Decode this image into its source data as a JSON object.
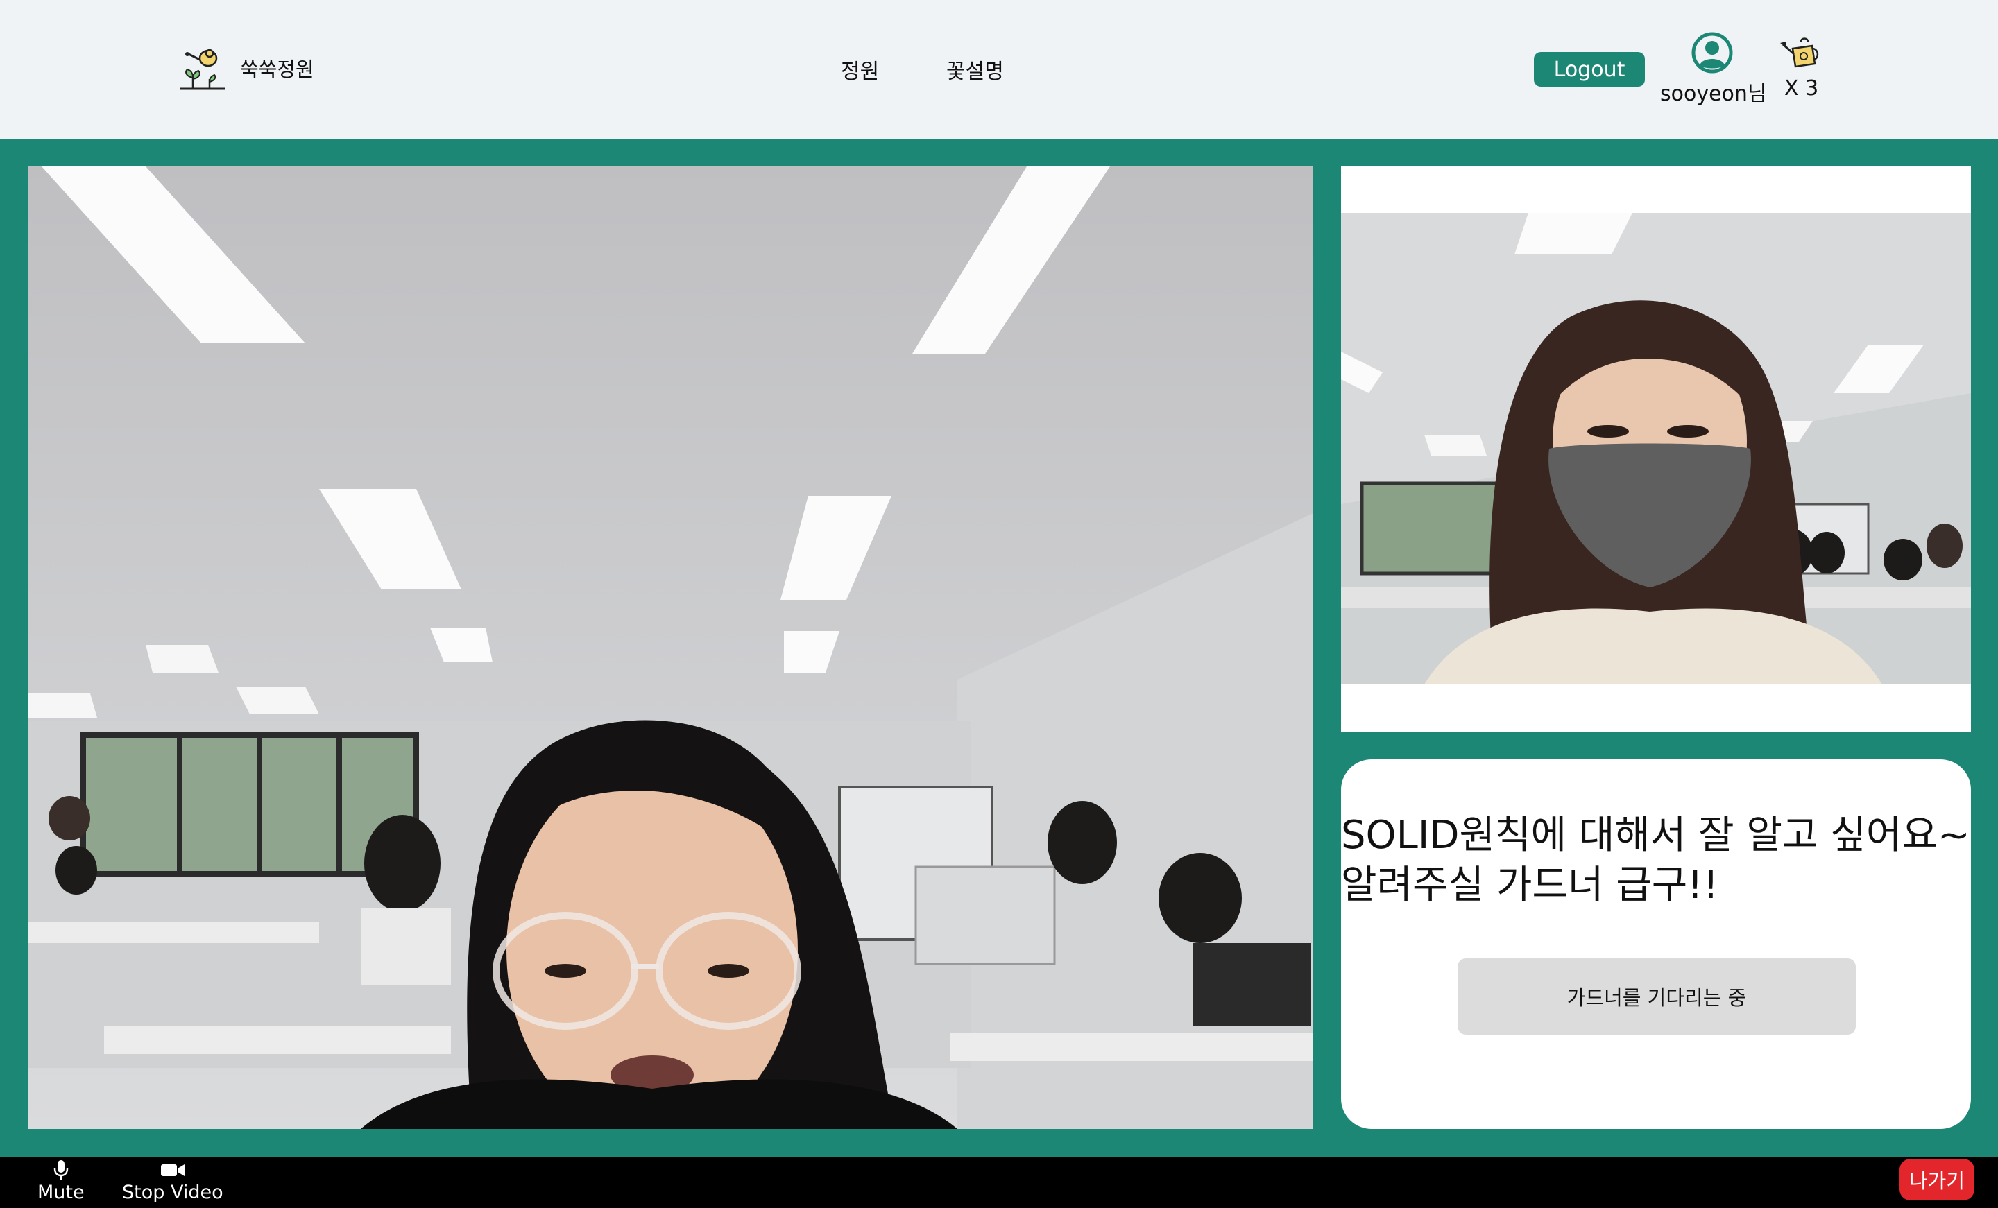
{
  "header": {
    "brand_name": "쑥쑥정원",
    "nav": [
      "정원",
      "꽃설명"
    ],
    "logout_label": "Logout",
    "user_name": "sooyeon님",
    "watering_count": "X 3"
  },
  "question": {
    "line1": "SOLID원칙에 대해서 잘 알고 싶어요~",
    "line2": "알려주실 가드너 급구!!",
    "waiting_label": "가드너를 기다리는 중"
  },
  "controls": {
    "mute_label": "Mute",
    "stop_video_label": "Stop Video",
    "leave_label": "나가기"
  },
  "colors": {
    "accent": "#1c8775",
    "header_bg": "#eff3f6",
    "leave": "#e2262b"
  }
}
